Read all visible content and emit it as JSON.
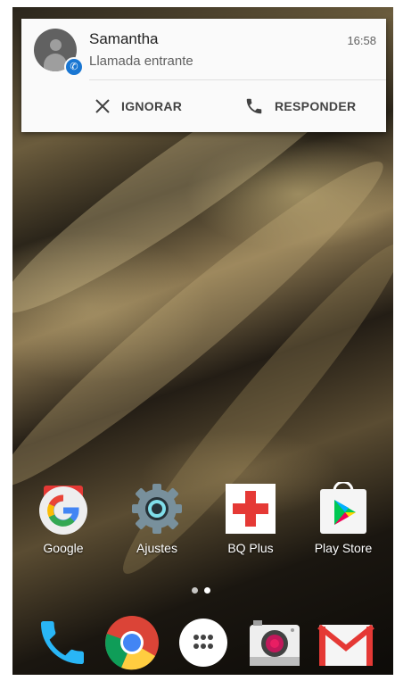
{
  "notification": {
    "caller": "Samantha",
    "status": "Llamada entrante",
    "time": "16:58",
    "dismiss_label": "IGNORAR",
    "answer_label": "RESPONDER"
  },
  "home_apps": [
    {
      "label": "Google",
      "icon": "google-icon"
    },
    {
      "label": "Ajustes",
      "icon": "settings-gear-icon"
    },
    {
      "label": "BQ Plus",
      "icon": "bq-plus-icon"
    },
    {
      "label": "Play Store",
      "icon": "play-store-icon"
    }
  ],
  "dock_apps": [
    {
      "name": "Teléfono",
      "icon": "phone-icon"
    },
    {
      "name": "Chrome",
      "icon": "chrome-icon"
    },
    {
      "name": "Aplicaciones",
      "icon": "app-drawer-icon"
    },
    {
      "name": "Cámara",
      "icon": "camera-icon"
    },
    {
      "name": "Gmail",
      "icon": "gmail-icon"
    }
  ],
  "pager": {
    "page_count": 2,
    "current_page": 1
  },
  "colors": {
    "accent": "#1976d2",
    "notification_bg": "#fafafa"
  }
}
